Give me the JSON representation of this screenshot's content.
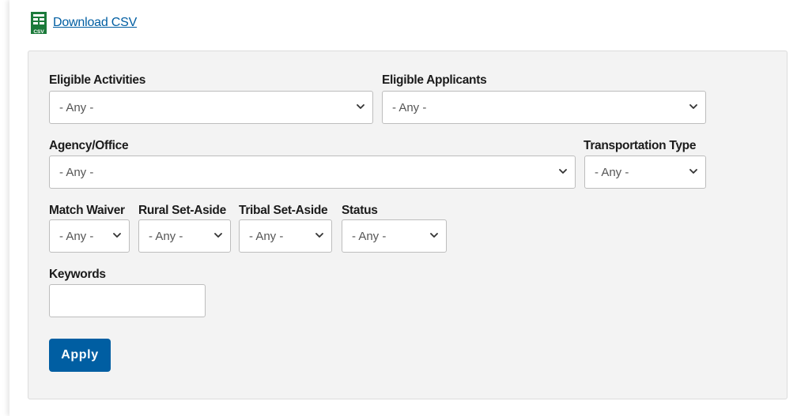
{
  "download": {
    "label": "Download CSV",
    "icon": "csv-file-icon",
    "icon_text": "CSV",
    "icon_color": "#1b7a3a"
  },
  "filters": {
    "eligible_activities": {
      "label": "Eligible Activities",
      "value": "- Any -"
    },
    "eligible_applicants": {
      "label": "Eligible Applicants",
      "value": "- Any -"
    },
    "agency_office": {
      "label": "Agency/Office",
      "value": "- Any -"
    },
    "transportation_type": {
      "label": "Transportation Type",
      "value": "- Any -"
    },
    "match_waiver": {
      "label": "Match Waiver",
      "value": "- Any -"
    },
    "rural_set_aside": {
      "label": "Rural Set-Aside",
      "value": "- Any -"
    },
    "tribal_set_aside": {
      "label": "Tribal Set-Aside",
      "value": "- Any -"
    },
    "status": {
      "label": "Status",
      "value": "- Any -"
    },
    "keywords": {
      "label": "Keywords",
      "value": ""
    }
  },
  "apply": {
    "label": "Apply"
  },
  "colors": {
    "link": "#005ea2",
    "button": "#005ea2",
    "panel_bg": "#f3f3f3"
  }
}
